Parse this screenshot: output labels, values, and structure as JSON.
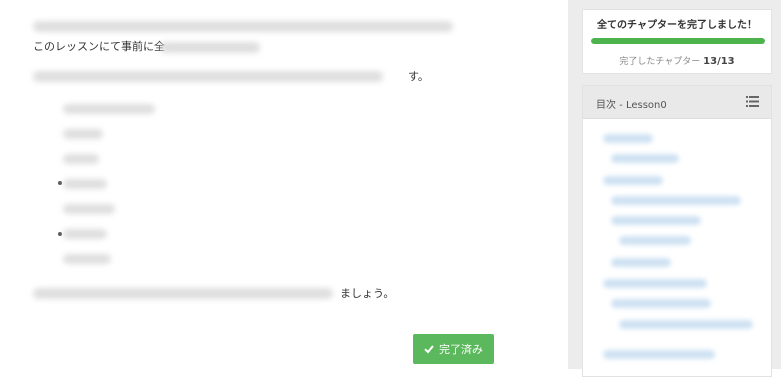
{
  "main": {
    "line2_visible": "このレッスンにて事前に全",
    "line3_visible": "す。",
    "line_bottom_visible": "ましょう。",
    "bullet_count": 9
  },
  "complete_button": {
    "icon": "check-icon",
    "label": "完了済み"
  },
  "progress": {
    "title": "全てのチャプターを完了しました！",
    "label": "完了したチャプター",
    "count": "13/13",
    "fraction": 1.0
  },
  "toc": {
    "title": "目次 - Lesson0",
    "icon": "list-icon"
  },
  "colors": {
    "accent_green": "#5cb85c",
    "progress_green": "#4db34d",
    "toc_link_blue": "#cfe2f3",
    "sidebar_bg": "#ececec"
  }
}
